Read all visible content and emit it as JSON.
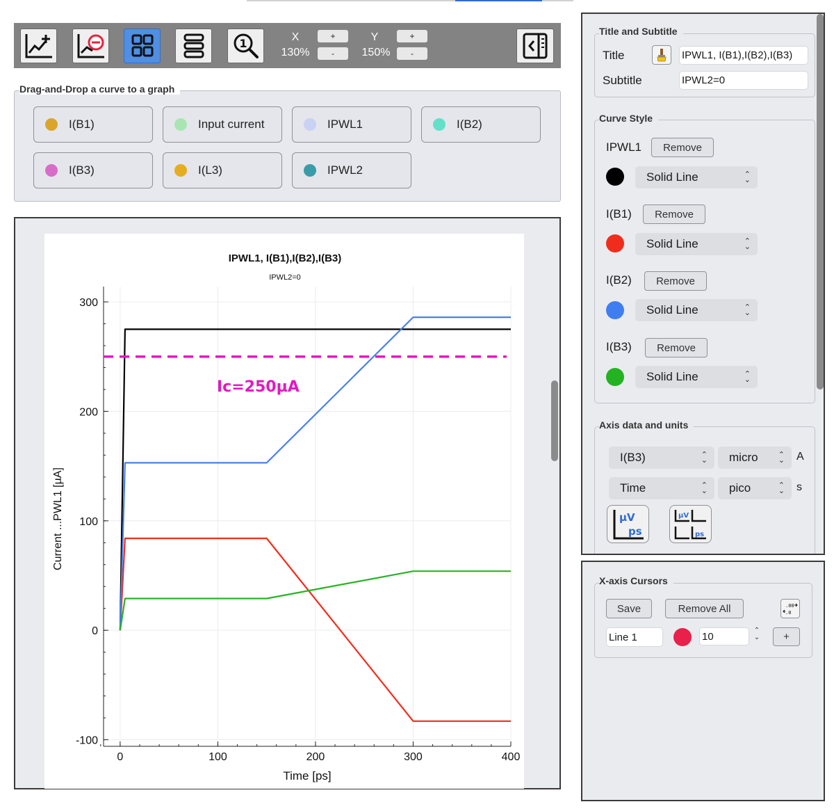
{
  "toolbar": {
    "icons": [
      "add-graph-icon",
      "remove-graph-icon",
      "grid-layout-icon",
      "stacked-layout-icon",
      "zoom-reset-icon",
      "collapse-panel-icon"
    ],
    "x_label": "X",
    "x_zoom": "130%",
    "y_label": "Y",
    "y_zoom": "150%",
    "plus": "+",
    "minus": "-"
  },
  "dnd": {
    "title": "Drag-and-Drop a curve to a graph",
    "curves": [
      {
        "label": "I(B1)",
        "color": "#d9a52b"
      },
      {
        "label": "Input current",
        "color": "#a8e5b3"
      },
      {
        "label": "IPWL1",
        "color": "#c9d2f5"
      },
      {
        "label": "I(B2)",
        "color": "#63e0c8"
      },
      {
        "label": "I(B3)",
        "color": "#d86dc8"
      },
      {
        "label": "I(L3)",
        "color": "#e6ad23"
      },
      {
        "label": "IPWL2",
        "color": "#3a9ca8"
      }
    ]
  },
  "plot": {
    "title": "IPWL1, I(B1),I(B2),I(B3)",
    "subtitle": "IPWL2=0",
    "annotation": "Ic=250µA",
    "annotation_color": "#e01bc0"
  },
  "chart_data": {
    "type": "line",
    "title": "IPWL1, I(B1),I(B2),I(B3)",
    "subtitle": "IPWL2=0",
    "xlabel": "Time [ps]",
    "ylabel": "Current ...PWL1 [µA]",
    "xlim": [
      -17,
      400
    ],
    "ylim": [
      -106,
      314
    ],
    "xticks": [
      0,
      100,
      200,
      300,
      400
    ],
    "yticks": [
      -100,
      0,
      100,
      200,
      300
    ],
    "grid": true,
    "series": [
      {
        "name": "IPWL1",
        "color": "#000000",
        "x": [
          0,
          5,
          400
        ],
        "y": [
          0,
          275,
          275
        ]
      },
      {
        "name": "I(B1)",
        "color": "#f02d1c",
        "x": [
          0,
          5,
          150,
          300,
          400
        ],
        "y": [
          0,
          84,
          84,
          -83,
          -83
        ]
      },
      {
        "name": "I(B2)",
        "color": "#4a7fe8",
        "x": [
          0,
          5,
          150,
          300,
          400
        ],
        "y": [
          0,
          153,
          153,
          286,
          286
        ]
      },
      {
        "name": "I(B3)",
        "color": "#27b324",
        "x": [
          0,
          5,
          150,
          300,
          400
        ],
        "y": [
          0,
          29,
          29,
          54,
          54
        ]
      }
    ],
    "hline": {
      "y": 250,
      "color": "#e01bc0",
      "style": "dashed",
      "label": "Ic=250µA"
    }
  },
  "right": {
    "title_group": "Title and Subtitle",
    "title_label": "Title",
    "title_value": "IPWL1, I(B1),I(B2),I(B3)",
    "subtitle_label": "Subtitle",
    "subtitle_value": "IPWL2=0",
    "style_group": "Curve Style",
    "remove_label": "Remove",
    "styles": [
      {
        "name": "IPWL1",
        "color": "#000000",
        "line": "Solid Line"
      },
      {
        "name": "I(B1)",
        "color": "#f02d1c",
        "line": "Solid Line"
      },
      {
        "name": "I(B2)",
        "color": "#3f7ef0",
        "line": "Solid Line"
      },
      {
        "name": "I(B3)",
        "color": "#24b223",
        "line": "Solid Line"
      }
    ],
    "axis_group": "Axis data and units",
    "y_axis_data": "I(B3)",
    "y_axis_prefix": "micro",
    "y_axis_unit": "A",
    "x_axis_data": "Time",
    "x_axis_prefix": "pico",
    "x_axis_unit": "s",
    "unit_btn1": "µV ps",
    "unit_btn2": "µV ps"
  },
  "cursors": {
    "group": "X-axis Cursors",
    "save": "Save",
    "remove_all": "Remove All",
    "line_name": "Line 1",
    "line_color": "#e8204a",
    "line_value": "10",
    "plus": "+"
  }
}
